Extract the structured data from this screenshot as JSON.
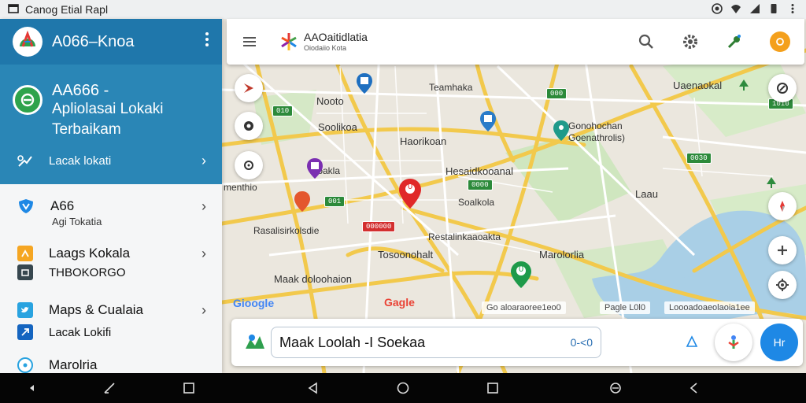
{
  "status_bar": {
    "app_title": "Canog Etial Rapl"
  },
  "sidebar": {
    "header_title": "A066–Knoa",
    "hero": {
      "line1": "AA666 -",
      "line2": "Apliolasai Lokaki",
      "line3": "Terbaikam",
      "link_label": "Lacak lokati"
    },
    "items": [
      {
        "label": "A66",
        "sub": "Agi Tokatia"
      },
      {
        "label": "Laags Kokala",
        "sub": "THBOKORGO"
      },
      {
        "label": "Maps & Cualaia",
        "sub": "Lacak Lokifi"
      },
      {
        "label": "Marolria"
      }
    ]
  },
  "topbar": {
    "title": "AAOaitidlatia",
    "subtitle": "Oiodaiio Kota"
  },
  "map": {
    "labels": [
      "Teamhaka",
      "Nooto",
      "Soolikoa",
      "Haorikoan",
      "Gonohochan",
      "Goenathrolis)",
      "Hesaidkooanal",
      "Uaenaokal",
      "Laau",
      "Soalkola",
      "Rasalisirkolsdie",
      "Restalinkaaoakta",
      "Tosoonohalt",
      "Marolorlia",
      "Maak doloohaion",
      "menthio",
      "Ooakla"
    ],
    "shields": [
      "010",
      "001",
      "0030",
      "1010",
      "0000",
      "000"
    ],
    "red_shield": "000000",
    "google_left": "Gioogle",
    "google_mid": "Gagle",
    "attribution_left": "Go aloaraoree1eo0",
    "attribution_mid": "Pagle L0l0",
    "attribution_right": "Loooadoaeolaoia1ee",
    "pin_labels": [
      "0",
      "0"
    ]
  },
  "bottombar": {
    "search_text": "Maak Loolah -I Soekaa",
    "kbd_hint": "0-<0",
    "fab_label": "Hr"
  },
  "colors": {
    "header": "#1f77ab",
    "hero": "#2a86b6",
    "accent": "#1e88e5",
    "road": "#f2c94c",
    "water": "#a9cfe6",
    "park": "#cfe6bf"
  }
}
